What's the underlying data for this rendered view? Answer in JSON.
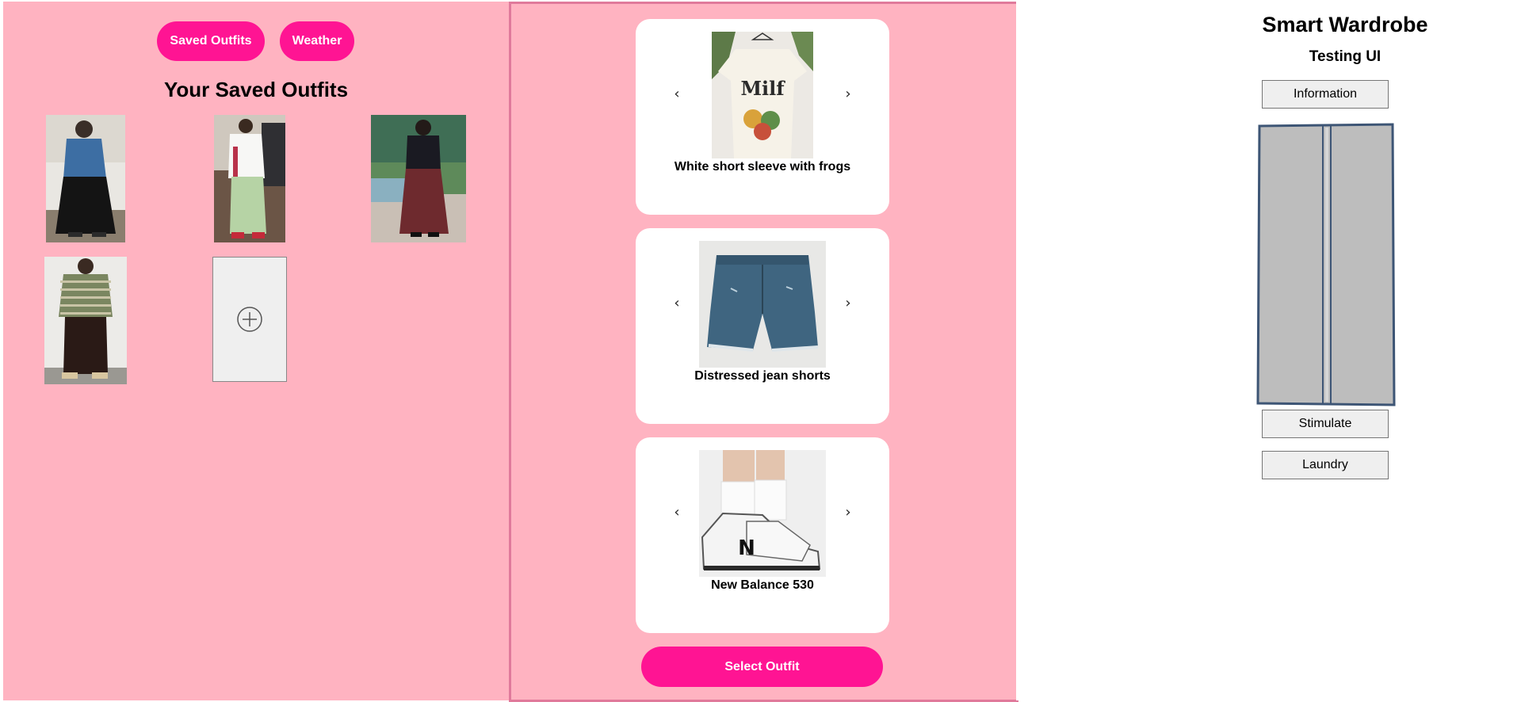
{
  "nav": {
    "saved_outfits": "Saved Outfits",
    "weather": "Weather"
  },
  "saved": {
    "title": "Your Saved Outfits",
    "outfits": [
      {
        "icon": "outfit-denim-shirt-black-pants-image"
      },
      {
        "icon": "outfit-white-shirt-green-pants-image"
      },
      {
        "icon": "outfit-black-top-maroon-pants-image"
      },
      {
        "icon": "outfit-striped-sweater-brown-pants-image"
      }
    ],
    "add_icon": "plus-circle-icon"
  },
  "selector": {
    "items": [
      {
        "label": "White short sleeve with frogs",
        "print_text": "Milf",
        "icon": "tshirt-image"
      },
      {
        "label": "Distressed jean shorts",
        "icon": "jean-shorts-image"
      },
      {
        "label": "New Balance 530",
        "shoe_letter": "N",
        "icon": "sneakers-image"
      }
    ],
    "prev": "‹",
    "next": "›",
    "select_label": "Select Outfit"
  },
  "app": {
    "title": "Smart Wardrobe",
    "subtitle": "Testing UI",
    "information": "Information",
    "stimulate": "Stimulate",
    "laundry": "Laundry"
  },
  "colors": {
    "panel_pink": "#ffb3c1",
    "accent_pink": "#ff1493",
    "panel_border": "#e07a9b",
    "wardrobe_gray": "#bdbdbd"
  }
}
